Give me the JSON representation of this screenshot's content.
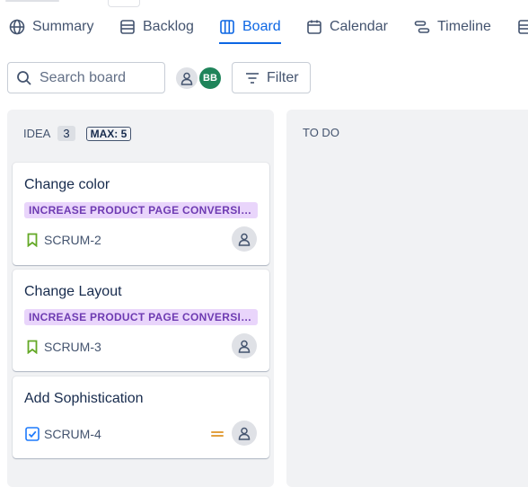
{
  "tabs": [
    {
      "label": "Summary",
      "icon": "globe-icon"
    },
    {
      "label": "Backlog",
      "icon": "backlog-icon"
    },
    {
      "label": "Board",
      "icon": "board-icon",
      "active": true
    },
    {
      "label": "Calendar",
      "icon": "calendar-icon"
    },
    {
      "label": "Timeline",
      "icon": "timeline-icon"
    }
  ],
  "toolbar": {
    "search_placeholder": "Search board",
    "avatar_initials": "BB",
    "filter_label": "Filter"
  },
  "columns": {
    "idea": {
      "title": "IDEA",
      "count": "3",
      "max": "MAX: 5",
      "cards": [
        {
          "title": "Change color",
          "epic": "INCREASE PRODUCT PAGE CONVERSIONS",
          "key": "SCRUM-2",
          "type": "story"
        },
        {
          "title": "Change Layout",
          "epic": "INCREASE PRODUCT PAGE CONVERSIONS",
          "key": "SCRUM-3",
          "type": "story"
        },
        {
          "title": "Add Sophistication",
          "epic": "",
          "key": "SCRUM-4",
          "type": "task",
          "priority": "medium"
        }
      ]
    },
    "todo": {
      "title": "TO DO"
    }
  },
  "colors": {
    "accent": "#0c66e4",
    "epic_bg": "#e9d5fb",
    "epic_text": "#6e3bb2",
    "story": "#63a825",
    "task": "#1d7afc",
    "priority_medium": "#e2a03f",
    "avatar_bb": "#1f845a"
  }
}
